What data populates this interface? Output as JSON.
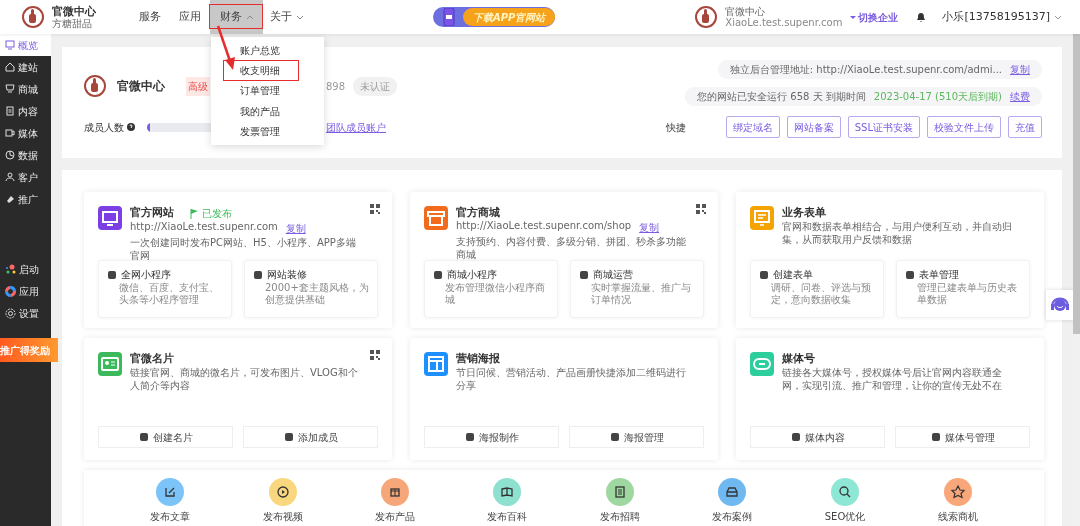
{
  "top_bar": {
    "brand": {
      "title": "官微中心",
      "subtitle": "方糖甜品"
    },
    "nav": [
      {
        "label": "服务",
        "kind": "link",
        "selected": false
      },
      {
        "label": "应用",
        "kind": "link",
        "selected": false
      },
      {
        "label": "财务",
        "kind": "menu",
        "selected": true,
        "expanded": true
      },
      {
        "label": "关于",
        "kind": "menu",
        "selected": false,
        "expanded": false
      }
    ],
    "promo": "下载APP官网站",
    "account": {
      "name": "官微中心",
      "domain": "XiaoLe.test.supenr.com",
      "switch": "切换企业",
      "user": "小乐[13758195137]"
    }
  },
  "dropdown": {
    "items": [
      {
        "label": "账户总览",
        "highlighted": false
      },
      {
        "label": "收支明细",
        "highlighted": true
      },
      {
        "label": "订单管理",
        "highlighted": false
      },
      {
        "label": "我的产品",
        "highlighted": false
      },
      {
        "label": "发票管理",
        "highlighted": false
      }
    ]
  },
  "sidebar": {
    "items": [
      {
        "label": "概览",
        "selected": true
      },
      {
        "label": "建站",
        "selected": false
      },
      {
        "label": "商城",
        "selected": false
      },
      {
        "label": "内容",
        "selected": false
      },
      {
        "label": "媒体",
        "selected": false
      },
      {
        "label": "数据",
        "selected": false
      },
      {
        "label": "客户",
        "selected": false
      },
      {
        "label": "推广",
        "selected": false
      }
    ],
    "tools": [
      {
        "label": "启动"
      },
      {
        "label": "应用"
      },
      {
        "label": "设置"
      }
    ],
    "banner": "推广得奖励"
  },
  "site_header": {
    "title": "官微中心",
    "tags": [
      {
        "text": "高级",
        "kind": "alert"
      },
      {
        "text": "898",
        "kind": "plain"
      },
      {
        "text": "未认证",
        "kind": "pill"
      }
    ],
    "members": {
      "label": "成员人数",
      "level": 0.02,
      "link": "团队成员账户"
    },
    "admin": {
      "label": "独立后台管理地址: http://XiaoLe.test.supenr.com/admi...",
      "action": "复制"
    },
    "runtime": {
      "label": "您的网站已安全运行 658 天  到期时间",
      "expiry": "2023-04-17 (510天后到期)",
      "action": "续费"
    },
    "quick": {
      "label": "快捷",
      "buttons": [
        "绑定域名",
        "网站备案",
        "SSL证书安装",
        "校验文件上传",
        "充值"
      ]
    }
  },
  "cards": [
    {
      "kind": "features",
      "title": "官方网站",
      "color": "#7b3fe4",
      "status": "已发布",
      "url": "http://XiaoLe.test.supenr.com",
      "copy": "复制",
      "desc": "一次创建同时发布PC网站、H5、小程序、APP多端官网",
      "qr": true,
      "features": [
        {
          "title": "全网小程序",
          "desc": "微信、百度、支付宝、头条等小程序管理"
        },
        {
          "title": "网站装修",
          "desc": "2000+套主题风格，为创意提供基础"
        }
      ]
    },
    {
      "kind": "features",
      "title": "官方商城",
      "color": "#f26b1d",
      "url": "http://XiaoLe.test.supenr.com/shop",
      "copy": "复制",
      "desc": "支持预约、内容付费、多级分销、拼团、秒杀多功能商城",
      "qr": true,
      "features": [
        {
          "title": "商城小程序",
          "desc": "发布管理微信小程序商城"
        },
        {
          "title": "商城运营",
          "desc": "实时掌握流量、推广与订单情况"
        }
      ]
    },
    {
      "kind": "features",
      "title": "业务表单",
      "color": "#f5a300",
      "desc": "官网和数据表单相结合，与用户便利互动，并自动归集，从而获取用户反馈和数据",
      "qr": false,
      "features": [
        {
          "title": "创建表单",
          "desc": "调研、问卷、评选与预定，意向数据收集"
        },
        {
          "title": "表单管理",
          "desc": "管理已建表单与历史表单数据"
        }
      ]
    },
    {
      "kind": "actions",
      "title": "官微名片",
      "color": "#3cb95a",
      "desc": "链接官网、商城的微名片，可发布图片、VLOG和个人简介等内容",
      "qr": true,
      "actions": [
        "创建名片",
        "添加成员"
      ]
    },
    {
      "kind": "actions",
      "title": "营销海报",
      "color": "#1e8fff",
      "desc": "节日问候、营销活动、产品画册快捷添加二维码进行分享",
      "qr": false,
      "actions": [
        "海报制作",
        "海报管理"
      ]
    },
    {
      "kind": "actions",
      "title": "媒体号",
      "color": "#2ccf9c",
      "desc": "链接各大媒体号，授权媒体号后让官网内容联通全网，实现引流、推广和管理，让你的宣传无处不在",
      "qr": false,
      "actions": [
        "媒体内容",
        "媒体号管理"
      ]
    }
  ],
  "shortcuts": [
    {
      "label": "发布文章",
      "color": "#7cc4f8"
    },
    {
      "label": "发布视频",
      "color": "#f9d77e"
    },
    {
      "label": "发布产品",
      "color": "#f5a77a"
    },
    {
      "label": "发布百科",
      "color": "#8ee0cf"
    },
    {
      "label": "发布招聘",
      "color": "#9ed8a0"
    },
    {
      "label": "发布案例",
      "color": "#6fb8f0"
    },
    {
      "label": "SEO优化",
      "color": "#8ee6d5"
    },
    {
      "label": "线索商机",
      "color": "#f7a77a"
    }
  ]
}
